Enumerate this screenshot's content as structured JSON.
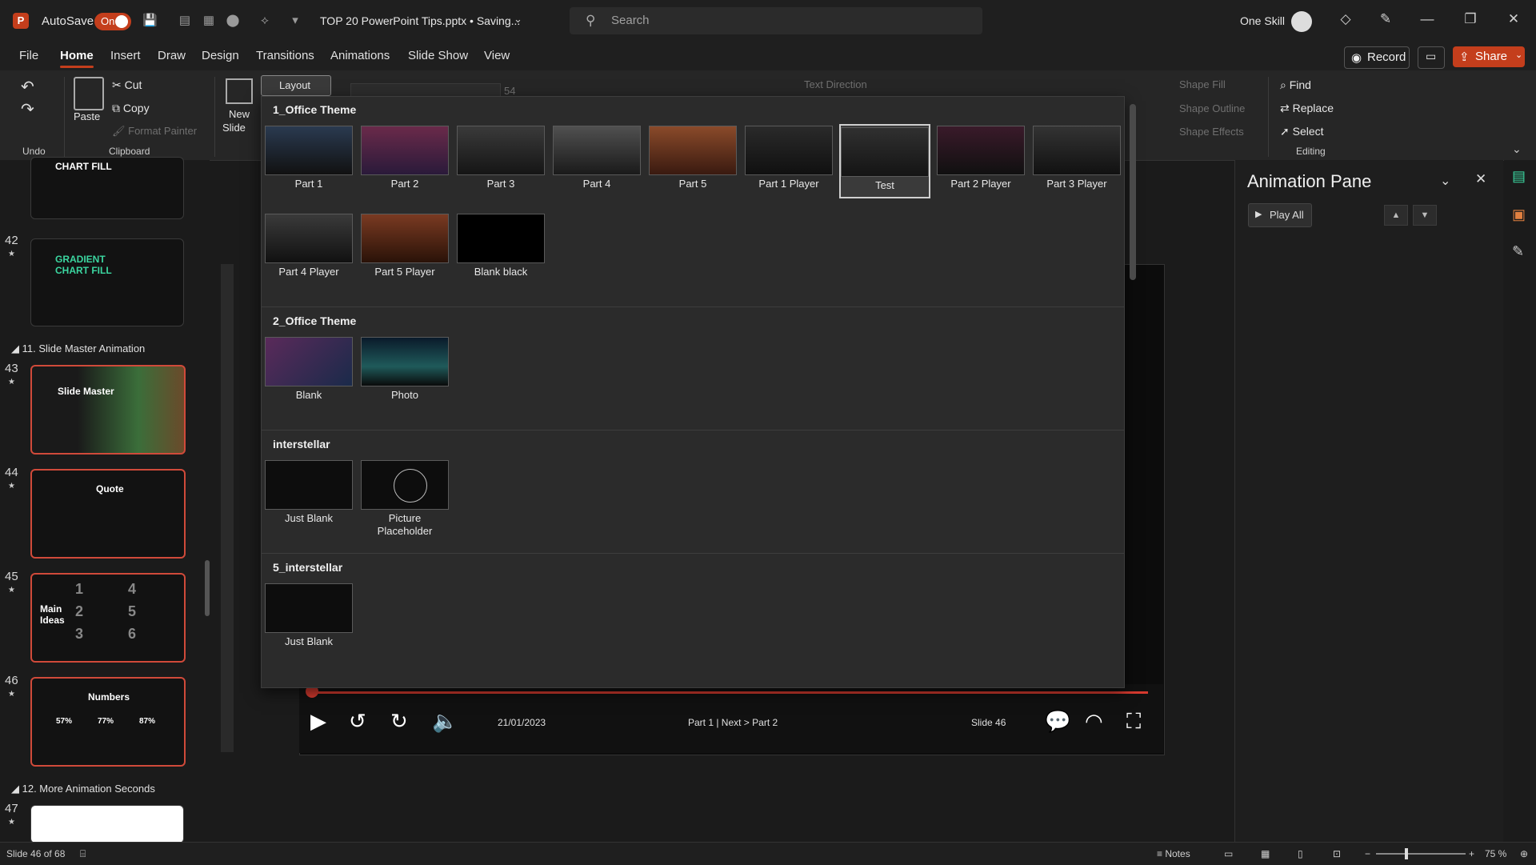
{
  "titlebar": {
    "app_initial": "P",
    "autosave_label": "AutoSave",
    "autosave_state": "On",
    "doc_title": "TOP 20 PowerPoint Tips.pptx • Saving...",
    "search_placeholder": "Search",
    "user_name": "One Skill"
  },
  "menu": {
    "tabs": [
      "File",
      "Home",
      "Insert",
      "Draw",
      "Design",
      "Transitions",
      "Animations",
      "Slide Show",
      "View"
    ],
    "active_tab": "Home",
    "record_label": "Record",
    "share_label": "Share"
  },
  "ribbon": {
    "undo_label": "Undo",
    "paste_label": "Paste",
    "cut_label": "Cut",
    "copy_label": "Copy",
    "format_painter_label": "Format Painter",
    "clipboard_label": "Clipboard",
    "new_slide_label": "New",
    "new_slide_label2": "Slide",
    "layout_label": "Layout",
    "font_size": "54",
    "text_direction_label": "Text Direction",
    "shape_fill_label": "Shape Fill",
    "shape_outline_label": "Shape Outline",
    "shape_effects_label": "Shape Effects",
    "find_label": "Find",
    "replace_label": "Replace",
    "select_label": "Select",
    "editing_label": "Editing"
  },
  "thumbnails": {
    "top_title": "CHART FILL",
    "slides": [
      {
        "num": "42",
        "title": "GRADIENT CHART FILL"
      },
      {
        "num": "43",
        "title": "Slide Master"
      },
      {
        "num": "44",
        "title": "Quote"
      },
      {
        "num": "45",
        "title": "Main Ideas"
      },
      {
        "num": "46",
        "title": "Numbers"
      },
      {
        "num": "47",
        "title": ""
      }
    ],
    "sections": [
      "11. Slide Master Animation",
      "12. More Animation Seconds"
    ],
    "numbers_values": [
      "57%",
      "77%",
      "87%"
    ],
    "main_ideas_digits": [
      "1",
      "2",
      "3",
      "4",
      "5",
      "6"
    ]
  },
  "layout_gallery": {
    "groups": [
      {
        "name": "1_Office Theme",
        "layouts": [
          "Part 1",
          "Part 2",
          "Part 3",
          "Part 4",
          "Part 5",
          "Part 1 Player",
          "Test",
          "Part 2 Player",
          "Part 3 Player",
          "Part 4 Player",
          "Part 5 Player",
          "Blank black"
        ]
      },
      {
        "name": "2_Office Theme",
        "layouts": [
          "Blank",
          "Photo"
        ]
      },
      {
        "name": "interstellar",
        "layouts": [
          "Just Blank",
          "Picture Placeholder"
        ]
      },
      {
        "name": "5_interstellar",
        "layouts": [
          "Just Blank"
        ]
      }
    ],
    "hovered": "Test"
  },
  "player": {
    "date": "21/01/2023",
    "breadcrumb": "Part 1 | Next > Part 2",
    "slide_label": "Slide 46"
  },
  "animation_pane": {
    "title": "Animation Pane",
    "play_all_label": "Play All"
  },
  "status": {
    "slide_count": "Slide 46 of 68",
    "notes_label": "Notes",
    "zoom": "75 %"
  },
  "colors": {
    "accent": "#c43e1c",
    "progress": "#d63a2f"
  }
}
